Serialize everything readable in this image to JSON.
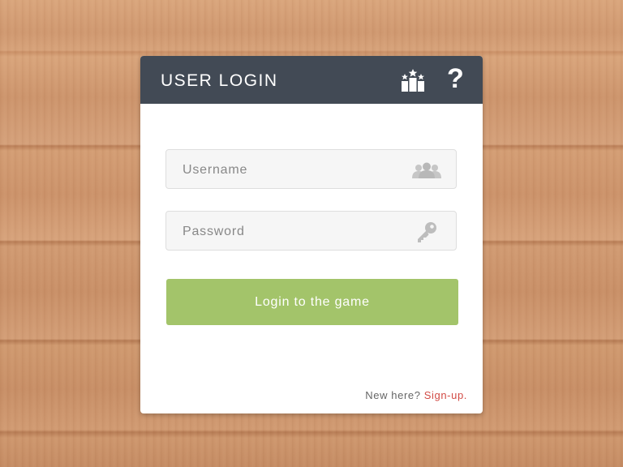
{
  "header": {
    "title": "USER LOGIN",
    "help_label": "?",
    "icons": [
      "podium-icon",
      "help-icon"
    ]
  },
  "form": {
    "username": {
      "placeholder": "Username",
      "value": "",
      "icon": "users-icon"
    },
    "password": {
      "placeholder": "Password",
      "value": "",
      "icon": "key-icon"
    },
    "submit_label": "Login to the game"
  },
  "footer": {
    "prompt": "New here?",
    "signup_label": "Sign-up."
  },
  "colors": {
    "header_bg": "#424a55",
    "button_bg": "#a3c46a",
    "link": "#d24b45",
    "field_bg": "#f6f6f6"
  }
}
